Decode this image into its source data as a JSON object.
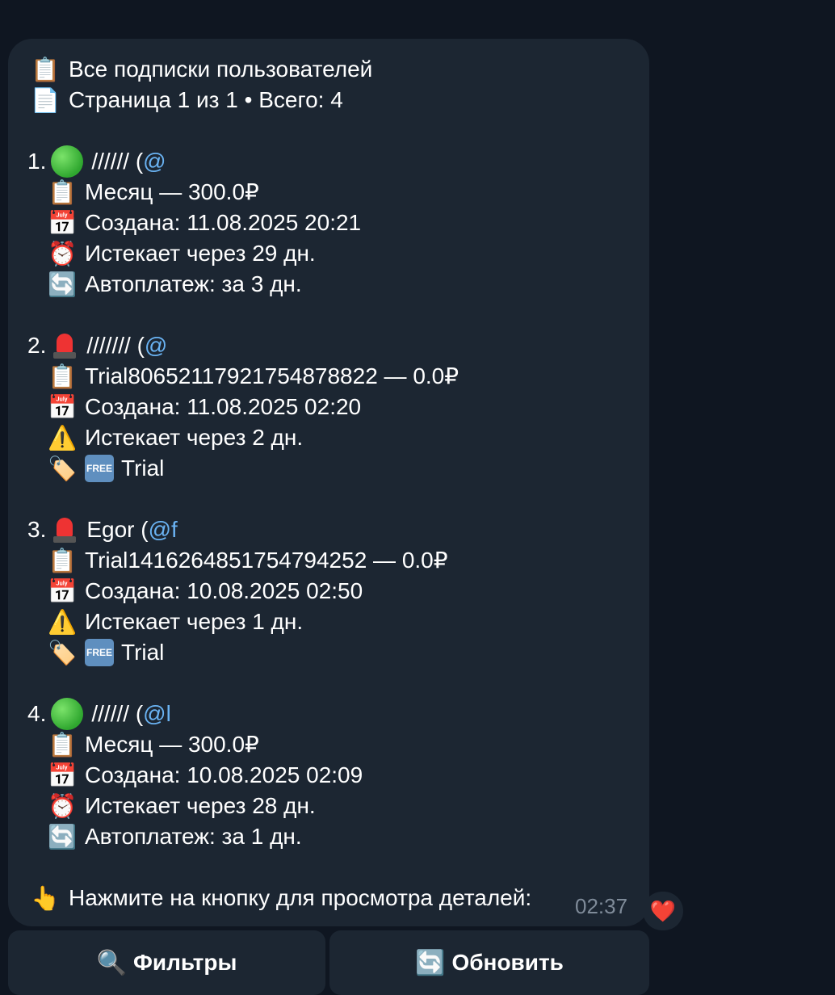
{
  "header": {
    "title_icon": "clipboard-icon",
    "title": "Все подписки пользователей",
    "page_icon": "page-icon",
    "page_info": "Страница 1 из 1 • Всего: 4"
  },
  "subscriptions": [
    {
      "index": "1.",
      "status_icon": "green-circle-icon",
      "name": "////// (",
      "handle": "@",
      "plan": "Месяц — 300.0₽",
      "created": "Создана: 11.08.2025 20:21",
      "expires_icon": "alarm-clock-icon",
      "expires": "Истекает через 29 дн.",
      "extra_icon": "refresh-icon",
      "extra": "Автоплатеж: за 3 дн."
    },
    {
      "index": "2.",
      "status_icon": "siren-icon",
      "name": "/////// (",
      "handle": "@",
      "plan": "Trial80652117921754878822 — 0.0₽",
      "created": "Создана: 11.08.2025 02:20",
      "expires_icon": "warning-icon",
      "expires": "Истекает через 2 дн.",
      "extra_icon": "label-tag-icon",
      "extra_badge": "FREE",
      "extra": "Trial"
    },
    {
      "index": "3.",
      "status_icon": "siren-icon",
      "name": "Egor (",
      "handle": "@f",
      "plan": "Trial14162648517547942​52 — 0.0₽",
      "created": "Создана: 10.08.2025 02:50",
      "expires_icon": "warning-icon",
      "expires": "Истекает через 1 дн.",
      "extra_icon": "label-tag-icon",
      "extra_badge": "FREE",
      "extra": "Trial"
    },
    {
      "index": "4.",
      "status_icon": "green-circle-icon",
      "name": "////// (",
      "handle": "@l",
      "plan": "Месяц — 300.0₽",
      "created": "Создана: 10.08.2025 02:09",
      "expires_icon": "alarm-clock-icon",
      "expires": "Истекает через 28 дн.",
      "extra_icon": "refresh-icon",
      "extra": "Автоплатеж: за 1 дн."
    }
  ],
  "footer": {
    "hint_icon": "pointing-up-hand-icon",
    "hint": "Нажмите на кнопку для просмотра деталей:",
    "time": "02:37",
    "reaction": "❤️"
  },
  "buttons": {
    "filters": "Фильтры",
    "filters_icon": "magnifier-icon",
    "refresh": "Обновить",
    "refresh_icon": "refresh-icon"
  },
  "colors": {
    "background": "#0f1621",
    "bubble": "#1c2632",
    "link": "#6ab3f3",
    "timestamp": "#7f8b99"
  }
}
